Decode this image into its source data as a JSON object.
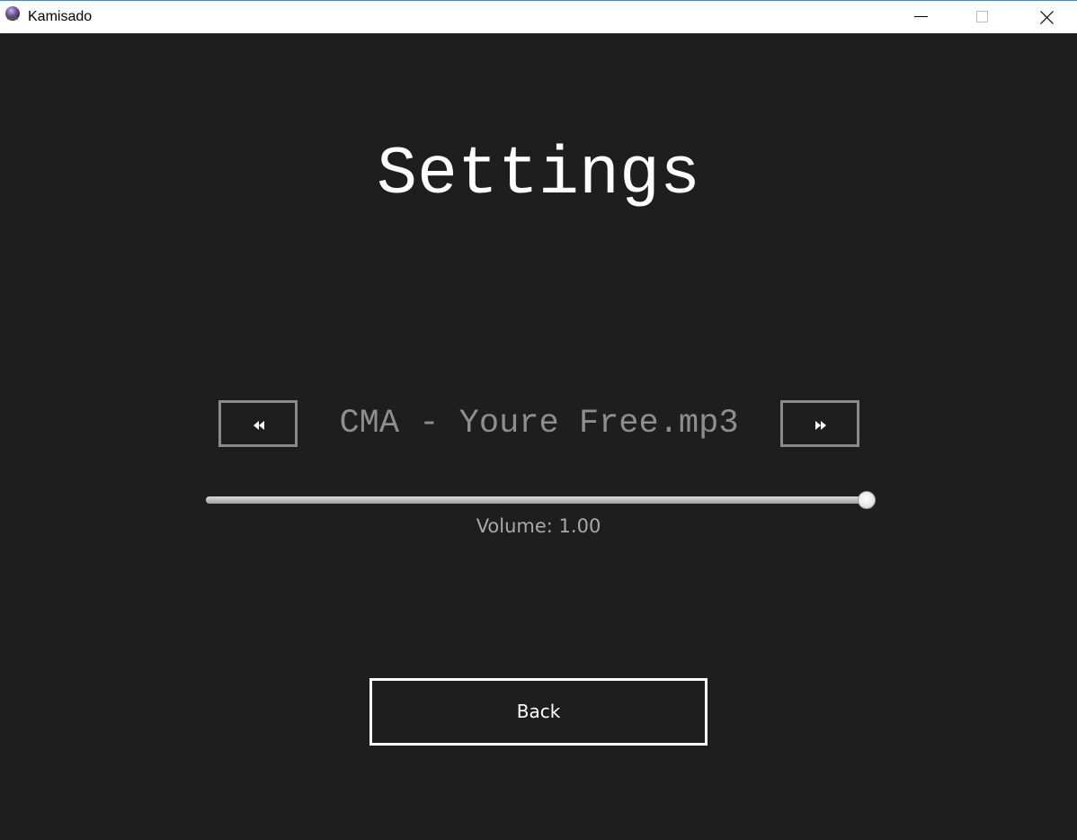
{
  "window": {
    "title": "Kamisado",
    "icon": "kamisado-app-icon"
  },
  "settings": {
    "heading": "Settings",
    "track": {
      "name": "CMA - Youre Free.mp3",
      "prev_icon": "rewind-icon",
      "next_icon": "fast-forward-icon"
    },
    "volume": {
      "label": "Volume: 1.00",
      "level": 1.0
    },
    "back_label": "Back"
  },
  "colors": {
    "background": "#1e1e1e",
    "heading": "#ffffff",
    "track_text": "#8e8e8e",
    "nav_border": "#8a8a8a",
    "volume_text": "#a9a9a9",
    "back_border": "#ffffff"
  }
}
